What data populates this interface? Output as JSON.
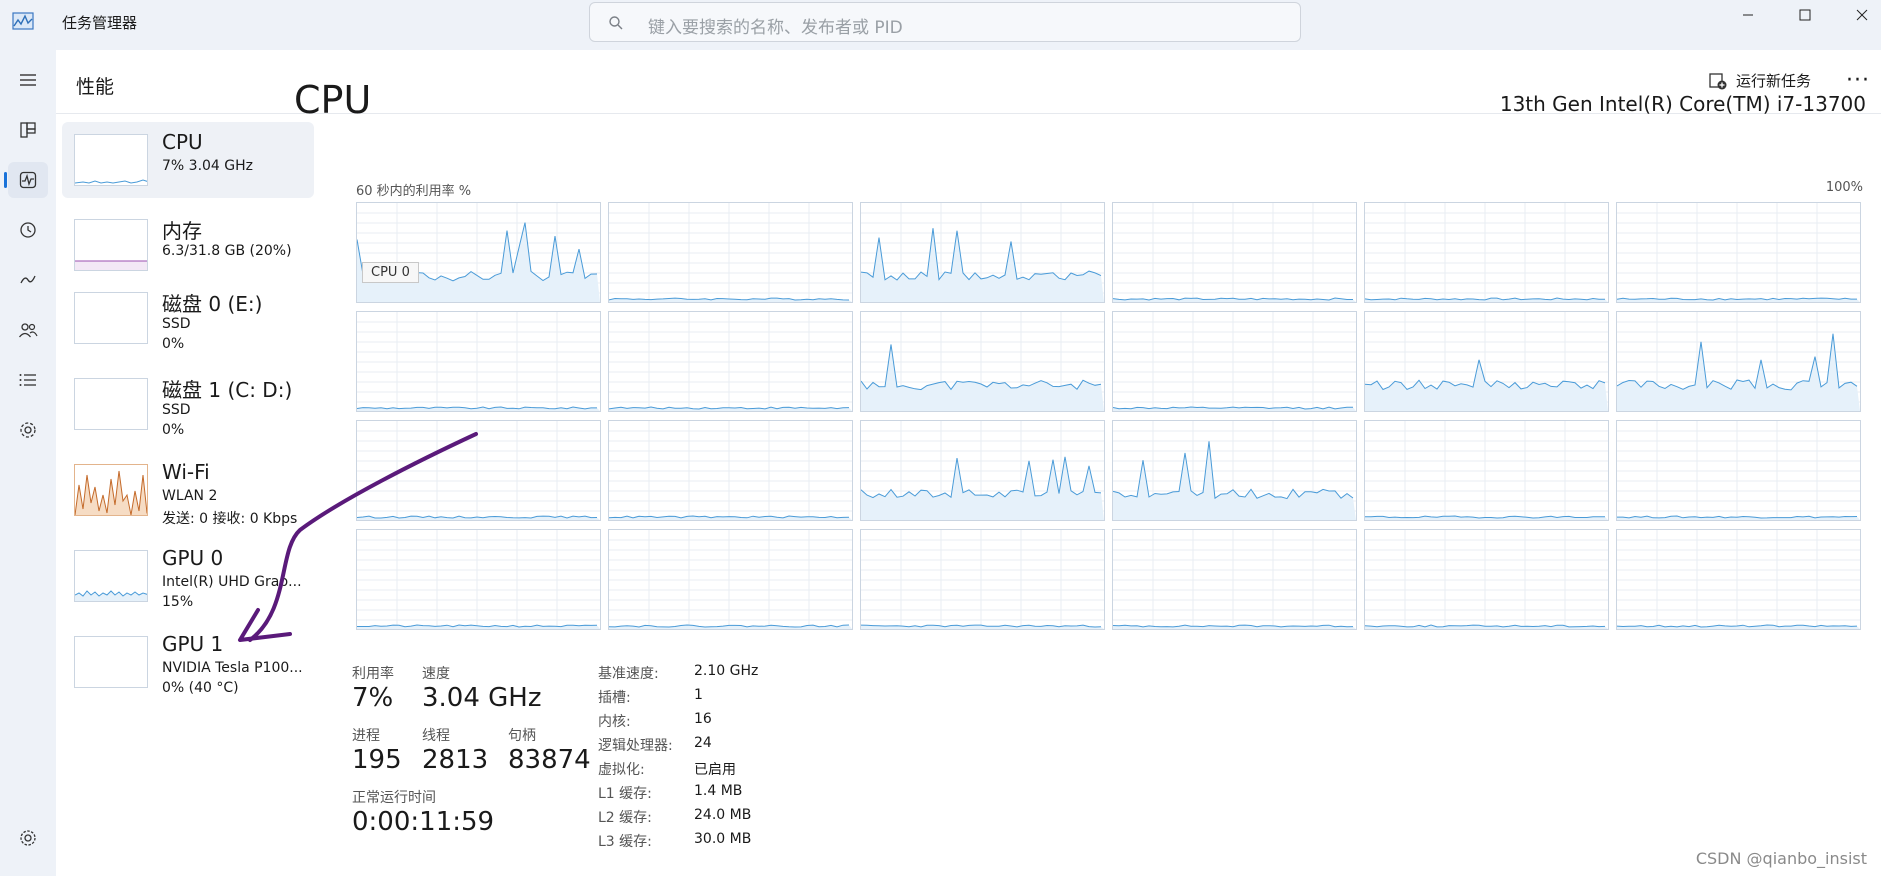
{
  "window": {
    "title": "任务管理器"
  },
  "search": {
    "placeholder": "键入要搜索的名称、发布者或 PID"
  },
  "header": {
    "page_title": "性能",
    "run_task": "运行新任务",
    "more": "···"
  },
  "nav": {
    "items": [
      "menu-icon",
      "processes-icon",
      "performance-icon",
      "history-icon",
      "startup-icon",
      "users-icon",
      "details-icon",
      "services-icon",
      "settings-icon"
    ]
  },
  "side": {
    "cpu": {
      "name": "CPU",
      "sub": "7% 3.04 GHz"
    },
    "memory": {
      "name": "内存",
      "sub": "6.3/31.8 GB (20%)"
    },
    "disk0": {
      "name": "磁盘 0 (E:)",
      "sub1": "SSD",
      "sub2": "0%"
    },
    "disk1": {
      "name": "磁盘 1 (C: D:)",
      "sub1": "SSD",
      "sub2": "0%"
    },
    "wifi": {
      "name": "Wi-Fi",
      "sub1": "WLAN 2",
      "sub2": "发送: 0 接收: 0 Kbps"
    },
    "gpu0": {
      "name": "GPU 0",
      "sub1": "Intel(R) UHD Grap...",
      "sub2": "15%"
    },
    "gpu1": {
      "name": "GPU 1",
      "sub1": "NVIDIA Tesla P100...",
      "sub2": "0% (40 °C)"
    }
  },
  "cpu": {
    "title": "CPU",
    "model": "13th Gen Intel(R) Core(TM) i7-13700",
    "util_label": "60 秒内的利用率 %",
    "util_max": "100%",
    "tooltip": "CPU 0",
    "colors": {
      "line": "#4a9bd8",
      "fill": "#e6f1fa",
      "grid": "#e8edf3",
      "border": "#cbd5e1"
    }
  },
  "stats": {
    "util_label": "利用率",
    "util_value": "7%",
    "speed_label": "速度",
    "speed_value": "3.04 GHz",
    "proc_label": "进程",
    "proc_value": "195",
    "threads_label": "线程",
    "threads_value": "2813",
    "handles_label": "句柄",
    "handles_value": "83874",
    "uptime_label": "正常运行时间",
    "uptime_value": "0:00:11:59"
  },
  "details": [
    {
      "label": "基准速度:",
      "value": "2.10 GHz"
    },
    {
      "label": "插槽:",
      "value": "1"
    },
    {
      "label": "内核:",
      "value": "16"
    },
    {
      "label": "逻辑处理器:",
      "value": "24"
    },
    {
      "label": "虚拟化:",
      "value": "已启用"
    },
    {
      "label": "L1 缓存:",
      "value": "1.4 MB"
    },
    {
      "label": "L2 缓存:",
      "value": "24.0 MB"
    },
    {
      "label": "L3 缓存:",
      "value": "30.0 MB"
    }
  ],
  "watermark": "CSDN @qianbo_insist"
}
